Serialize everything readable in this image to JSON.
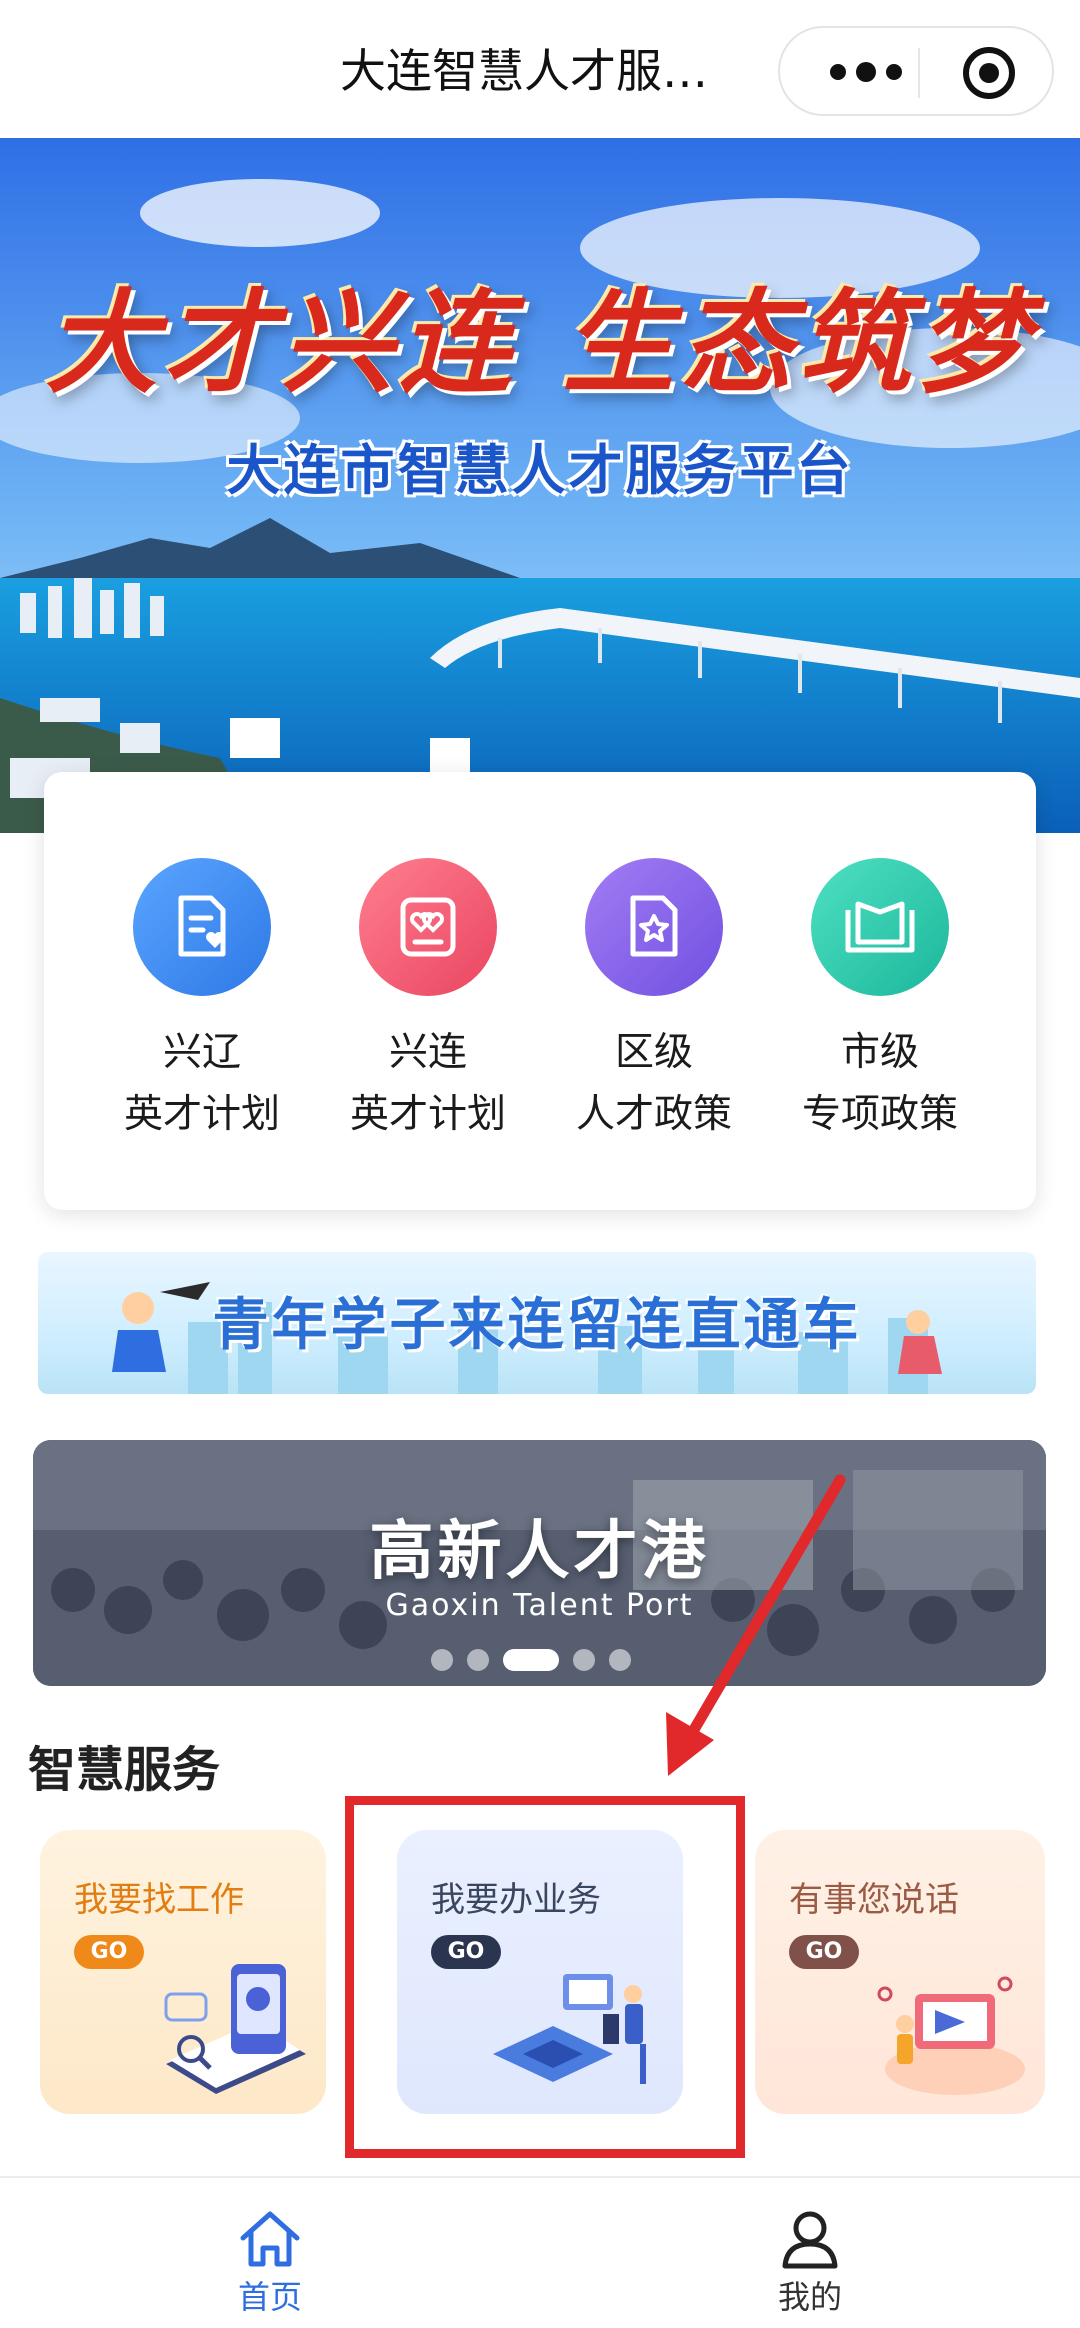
{
  "header": {
    "title": "大连智慧人才服…",
    "more_icon": "more-dots-icon",
    "close_icon": "target-close-icon"
  },
  "hero": {
    "slogan": "大才兴连  生态筑梦",
    "platform_name": "大连市智慧人才服务平台"
  },
  "services": [
    {
      "line1": "兴辽",
      "line2": "英才计划",
      "icon": "document-heart-icon",
      "color": "#3b8cf0"
    },
    {
      "line1": "兴连",
      "line2": "英才计划",
      "icon": "card-hearts-icon",
      "color": "#f0566e"
    },
    {
      "line1": "区级",
      "line2": "人才政策",
      "icon": "star-document-icon",
      "color": "#8a63e8"
    },
    {
      "line1": "市级",
      "line2": "专项政策",
      "icon": "open-book-icon",
      "color": "#2cc9b0"
    }
  ],
  "youth_banner": {
    "text": "青年学子来连留连直通车"
  },
  "carousel": {
    "title": "高新人才港",
    "subtitle": "Gaoxin Talent Port",
    "slide_count": 5,
    "active_index": 2
  },
  "smart_services": {
    "title": "智慧服务",
    "tiles": [
      {
        "label": "我要找工作",
        "go": "GO"
      },
      {
        "label": "我要办业务",
        "go": "GO"
      },
      {
        "label": "有事您说话",
        "go": "GO"
      }
    ]
  },
  "annotation": {
    "highlight_color": "#e1282a"
  },
  "tabbar": {
    "home": "首页",
    "mine": "我的",
    "active_color": "#2f6ee0"
  }
}
